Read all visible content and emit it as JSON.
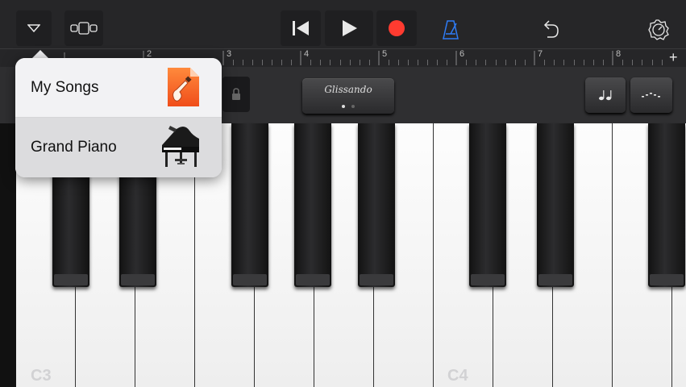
{
  "colors": {
    "record": "#ff3b30",
    "metronome_active": "#2f7cf6",
    "popover_bg": "#f2f2f4",
    "selected_row": "#dcdcde"
  },
  "toolbar": {
    "icons": [
      "browser-toggle-icon",
      "tracks-view-icon",
      "rewind-icon",
      "play-icon",
      "record-icon",
      "metronome-icon",
      "undo-icon",
      "settings-icon"
    ]
  },
  "ruler": {
    "bars": [
      "2",
      "3",
      "4",
      "5",
      "6",
      "7",
      "8"
    ],
    "add": "+"
  },
  "controls": {
    "glissando": "Glissando"
  },
  "keyboard": {
    "labels": [
      "C3",
      "C4"
    ]
  },
  "popover": {
    "items": [
      {
        "label": "My Songs",
        "icon": "garageband-document-icon",
        "selected": false
      },
      {
        "label": "Grand Piano",
        "icon": "grand-piano-icon",
        "selected": true
      }
    ]
  }
}
